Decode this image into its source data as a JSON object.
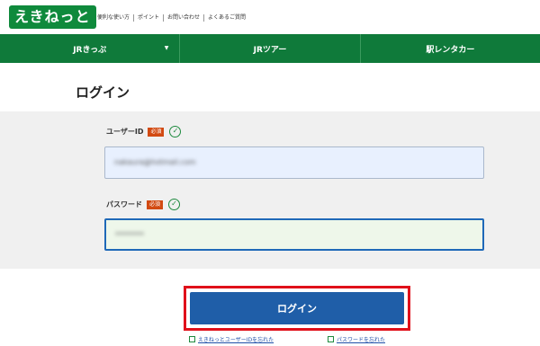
{
  "header": {
    "logo": "えきねっと",
    "links": [
      "便利な使い方",
      "ポイント",
      "お問い合わせ",
      "よくあるご質問"
    ]
  },
  "nav": {
    "items": [
      "JRきっぷ",
      "JRツアー",
      "駅レンタカー"
    ]
  },
  "page": {
    "title": "ログイン"
  },
  "form": {
    "user_label": "ユーザーID",
    "user_required": "必須",
    "user_value": "nakaura@hotmail.com",
    "password_label": "パスワード",
    "password_required": "必須",
    "password_value": "********"
  },
  "actions": {
    "login_label": "ログイン",
    "forgot_user_id": "えきねっとユーザーIDを忘れた",
    "forgot_password": "パスワードを忘れた"
  },
  "colors": {
    "brand_green": "#0f7a3a",
    "login_blue": "#1f5ea8",
    "highlight_red": "#e0101a",
    "required_badge": "#d24a12"
  }
}
